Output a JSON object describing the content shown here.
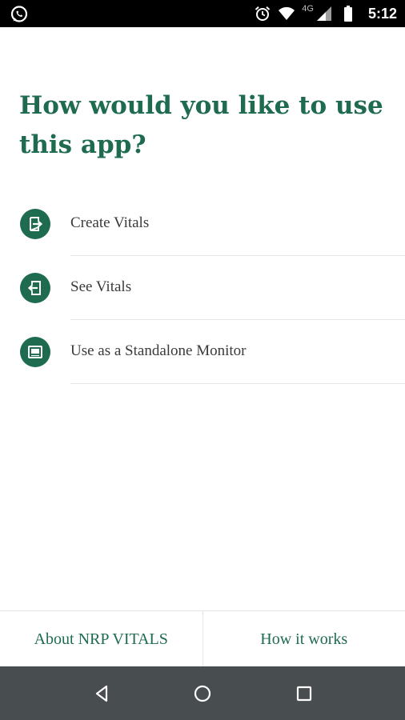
{
  "status_bar": {
    "network_type": "4G",
    "time": "5:12",
    "icons": [
      "whatsapp-icon",
      "alarm-icon",
      "wifi-icon",
      "signal-icon",
      "battery-icon"
    ]
  },
  "main": {
    "question": "How would you like to use this app?",
    "options": [
      {
        "label": "Create Vitals",
        "icon": "create-vitals-icon"
      },
      {
        "label": "See Vitals",
        "icon": "see-vitals-icon"
      },
      {
        "label": "Use as a Standalone Monitor",
        "icon": "monitor-icon"
      }
    ]
  },
  "footer": {
    "about_label": "About NRP VITALS",
    "how_label": "How it works"
  },
  "nav_bar": {
    "icons": [
      "back-icon",
      "home-icon",
      "recents-icon"
    ]
  },
  "colors": {
    "accent": "#1e6b4f",
    "status_bar": "#000000",
    "nav_bar": "#484d4f",
    "divider": "#e6e6e6"
  }
}
